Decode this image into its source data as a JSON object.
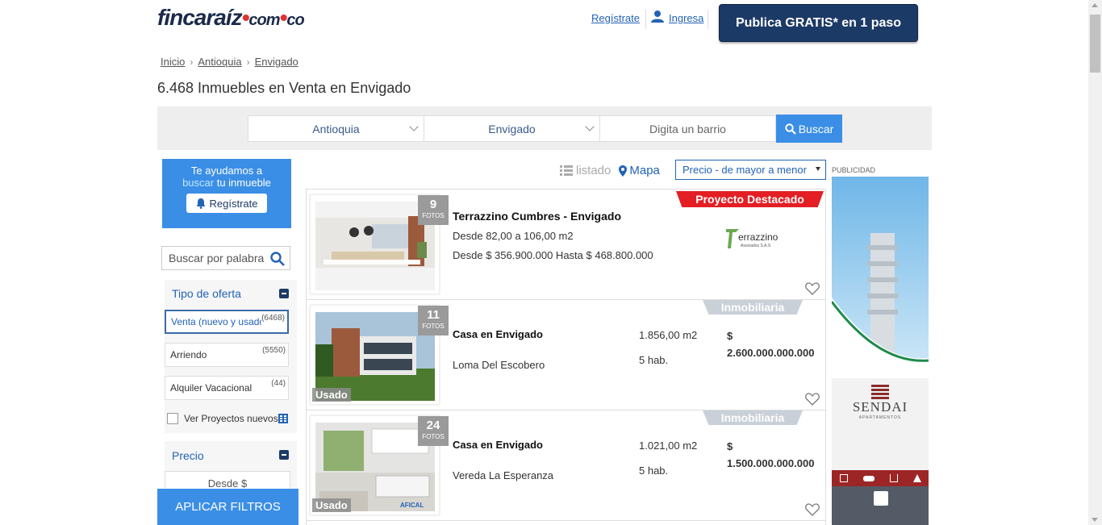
{
  "header": {
    "logo_main": "fincaraíz",
    "logo_com": "com",
    "logo_co": "co",
    "register_link": "Regístrate",
    "login_link": "Ingresa",
    "publish_button": "Publica GRATIS* en 1 paso"
  },
  "breadcrumb": [
    "Inicio",
    "Antioquia",
    "Envigado"
  ],
  "page_title": "6.468 Inmuebles en Venta en Envigado",
  "search": {
    "department": "Antioquia",
    "city": "Envigado",
    "barrio_placeholder": "Digita un barrio",
    "button": "Buscar"
  },
  "help_box": {
    "line1": "Te ayudamos a",
    "buscar": "buscar",
    "rest": " tu inmueble",
    "button": "Regístrate"
  },
  "keyword_search": {
    "placeholder": "Buscar por palabra"
  },
  "filters": {
    "tipo_oferta_label": "Tipo de oferta",
    "options": [
      {
        "label": "Venta (nuevo y usado)",
        "count": "(6468)"
      },
      {
        "label": "Arriendo",
        "count": "(5550)"
      },
      {
        "label": "Alquiler Vacacional",
        "count": "(44)"
      }
    ],
    "ver_proyectos": "Ver Proyectos nuevos",
    "precio_label": "Precio",
    "desde_placeholder": "Desde $",
    "apply_button": "APLICAR FILTROS"
  },
  "view": {
    "listado": "listado",
    "mapa": "Mapa",
    "sort": "Precio - de mayor a menor"
  },
  "listings": [
    {
      "photos": "9",
      "photos_label": "FOTOS",
      "badge": "Proyecto Destacado",
      "title": "Terrazzino Cumbres - Envigado",
      "area": "Desde 82,00 a 106,00 m2",
      "price": "Desde $ 356.900.000 Hasta $ 468.800.000",
      "logo_text": "errazzino",
      "logo_sub": "Asociados S.A.S"
    },
    {
      "photos": "11",
      "photos_label": "FOTOS",
      "badge": "Inmobiliaria",
      "condition": "Usado",
      "title": "Casa en Envigado",
      "location": "Loma Del Escobero",
      "area": "1.856,00 m2",
      "rooms": "5 hab.",
      "price_symbol": "$",
      "price": "2.600.000.000.000"
    },
    {
      "photos": "24",
      "photos_label": "FOTOS",
      "badge": "Inmobiliaria",
      "condition": "Usado",
      "title": "Casa en Envigado",
      "location": "Vereda La Esperanza",
      "area": "1.021,00 m2",
      "rooms": "5 hab.",
      "price_symbol": "$",
      "price": "1.500.000.000.000"
    }
  ],
  "ads": {
    "label": "PUBLICIDAD",
    "sendai": "SENDAI",
    "sendai_sub": "APARTAMENTOS"
  },
  "colors": {
    "primary": "#3b8ee6",
    "dark_blue": "#1c3a66",
    "link": "#2363b5",
    "red_badge": "#e31e24"
  }
}
